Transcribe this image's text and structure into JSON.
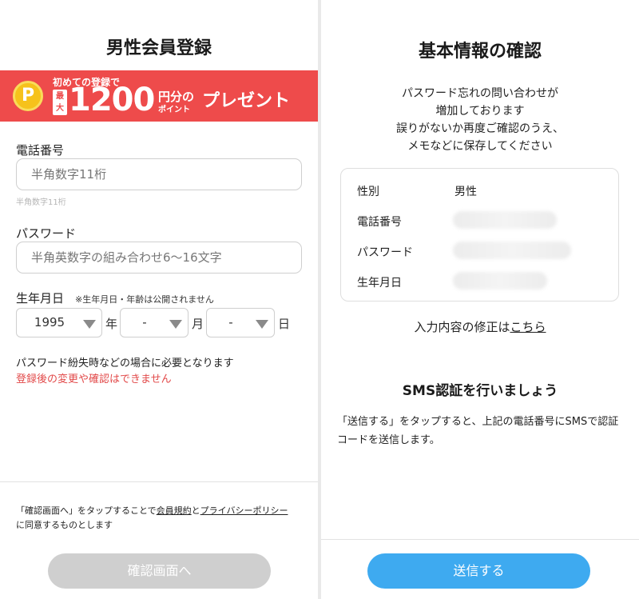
{
  "left": {
    "title": "男性会員登録",
    "banner": {
      "coin": "P",
      "top_text": "初めての登録で",
      "max_label": "最大",
      "amount": "1200",
      "unit_line1": "円分の",
      "unit_line2": "ポイント",
      "present": "プレゼント"
    },
    "phone": {
      "label": "電話番号",
      "placeholder": "半角数字11桁",
      "hint": "半角数字11桁"
    },
    "password": {
      "label": "パスワード",
      "placeholder": "半角英数字の組み合わせ6〜16文字"
    },
    "birth": {
      "label": "生年月日",
      "note": "※生年月日・年齢は公開されません",
      "year_value": "1995",
      "year_unit": "年",
      "month_value": "-",
      "month_unit": "月",
      "day_value": "-",
      "day_unit": "日"
    },
    "info_black": "パスワード紛失時などの場合に必要となります",
    "info_red": "登録後の変更や確認はできません",
    "terms": {
      "prefix": "「確認画面へ」をタップすることで",
      "link1": "会員規約",
      "mid": "と",
      "link2": "プライバシーポリシー",
      "suffix": "に同意するものとします"
    },
    "button": "確認画面へ"
  },
  "right": {
    "title": "基本情報の確認",
    "notice": [
      "パスワード忘れの問い合わせが",
      "増加しております",
      "誤りがないか再度ご確認のうえ、",
      "メモなどに保存してください"
    ],
    "rows": [
      {
        "label": "性別",
        "value": "男性"
      },
      {
        "label": "電話番号",
        "value": ""
      },
      {
        "label": "パスワード",
        "value": ""
      },
      {
        "label": "生年月日",
        "value": ""
      }
    ],
    "modify_prefix": "入力内容の修正は",
    "modify_link": "こちら",
    "sms_title": "SMS認証を行いましょう",
    "sms_desc": "「送信する」をタップすると、上記の電話番号にSMSで認証コードを送信します。",
    "button": "送信する"
  },
  "colors": {
    "banner_red": "#ee4b4b",
    "coin_yellow": "#f6c21b",
    "warning_red": "#e24a4a",
    "send_blue": "#3eaaf0",
    "disabled_gray": "#cfcfcf"
  }
}
